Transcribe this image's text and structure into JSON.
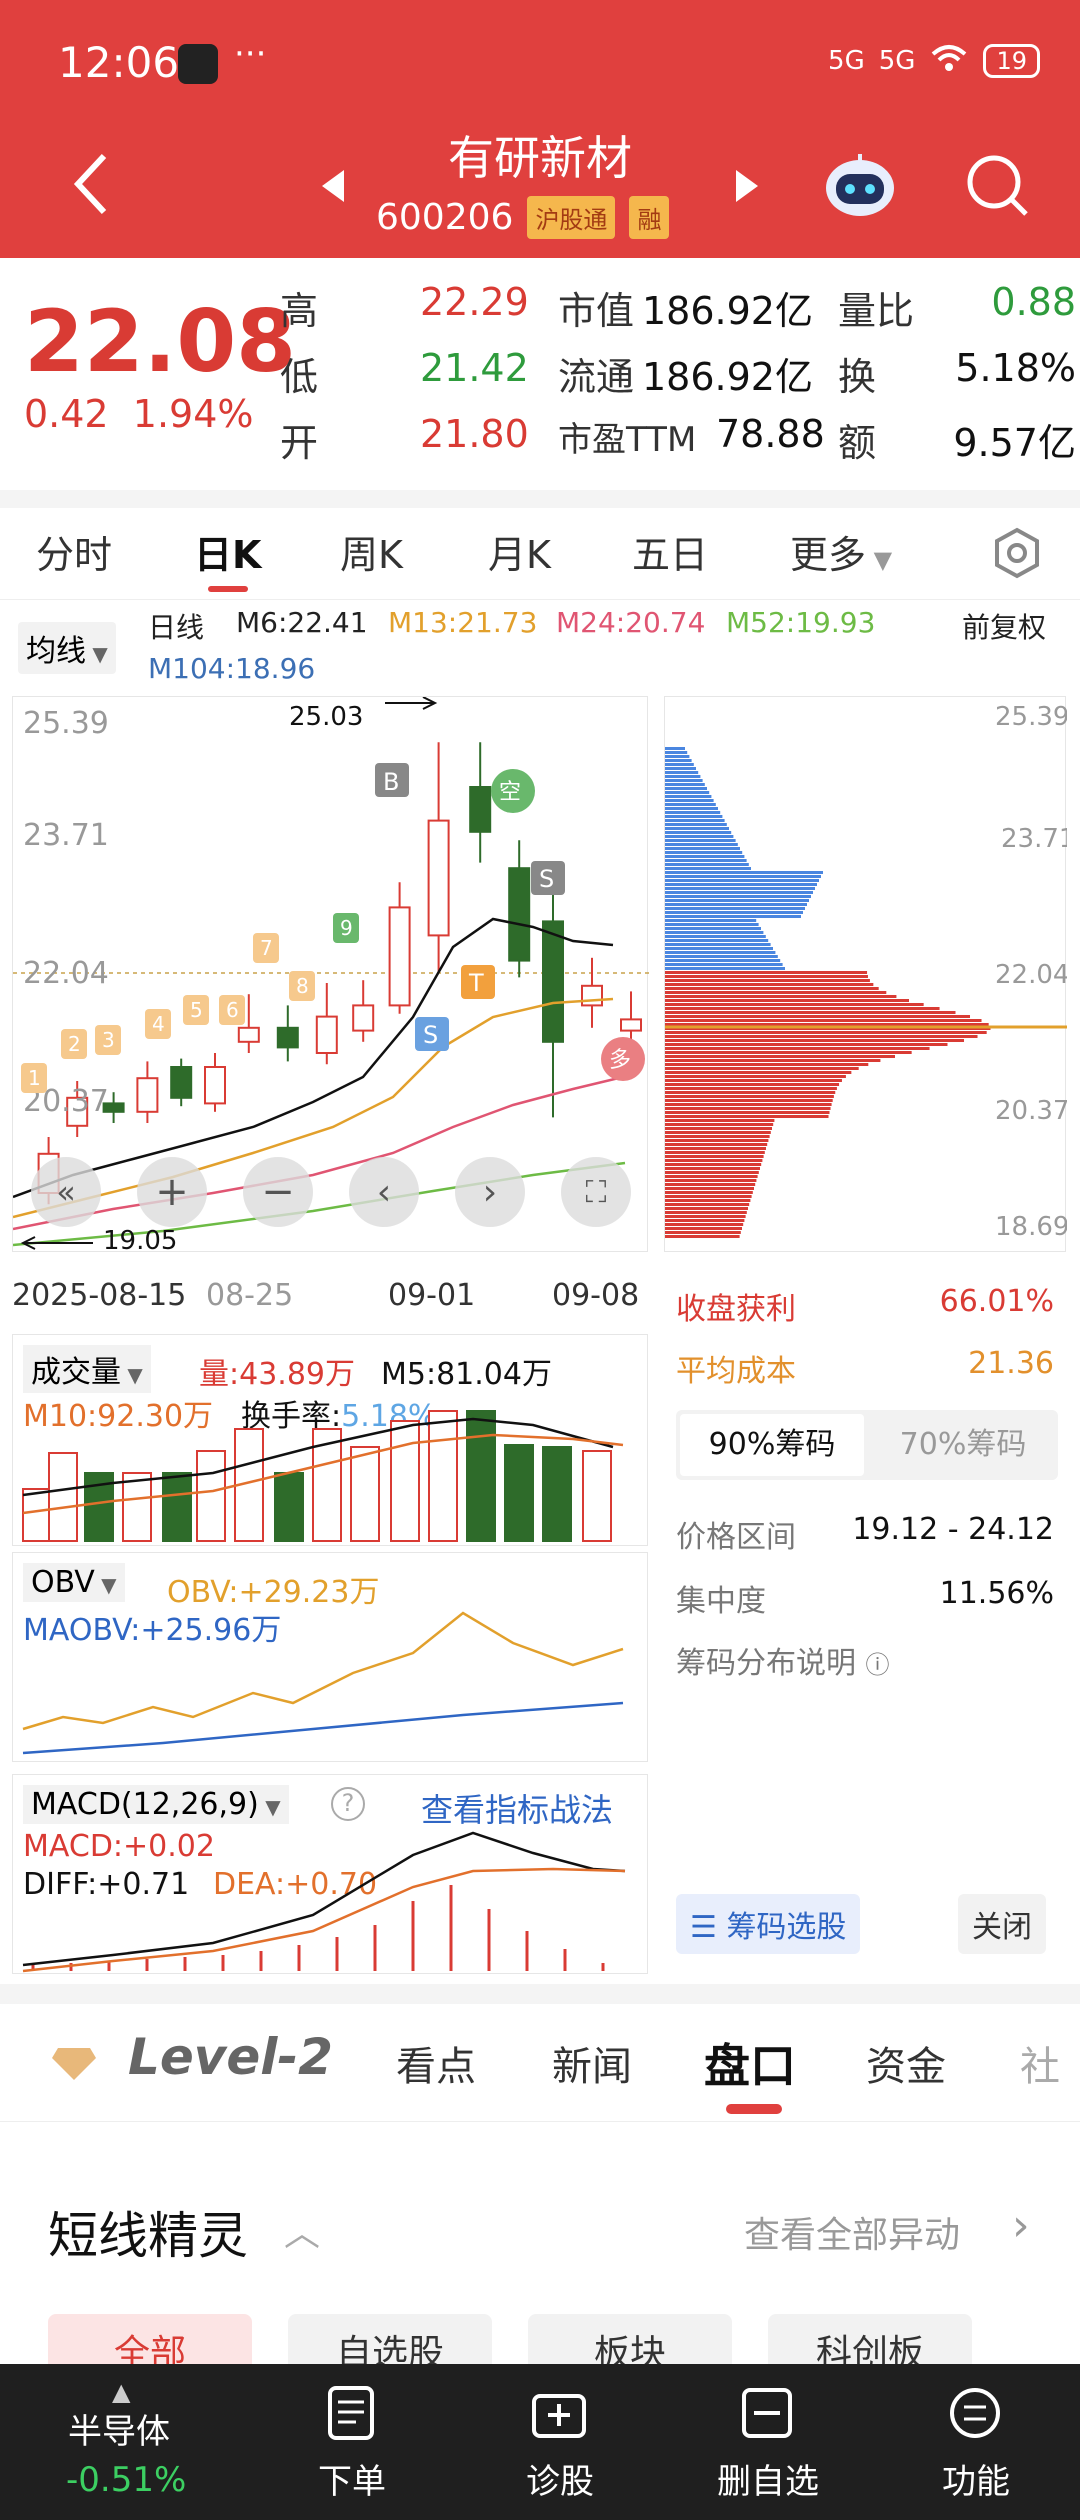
{
  "status_bar": {
    "time": "12:06",
    "dots": "···",
    "signal1": "5G",
    "signal2": "5G",
    "battery": "19"
  },
  "header": {
    "stock_name": "有研新材",
    "stock_code": "600206",
    "tag1": "沪股通",
    "tag2": "融"
  },
  "quote": {
    "price": "22.08",
    "change": "0.42",
    "change_pct": "1.94%",
    "high_label": "高",
    "high": "22.29",
    "low_label": "低",
    "low": "21.42",
    "open_label": "开",
    "open": "21.80",
    "mcap_label": "市值",
    "mcap": "186.92亿",
    "float_label": "流通",
    "float": "186.92亿",
    "pe_label": "市盈TTM",
    "pe": "78.88",
    "vr_label": "量比",
    "vr": "0.88",
    "turn_label": "换",
    "turn": "5.18%",
    "amt_label": "额",
    "amt": "9.57亿"
  },
  "tabs": [
    "分时",
    "日K",
    "周K",
    "月K",
    "五日",
    "更多"
  ],
  "ma": {
    "selector": "均线",
    "type": "日线",
    "m6": "M6:22.41",
    "m13": "M13:21.73",
    "m24": "M24:20.74",
    "m52": "M52:19.93",
    "m104": "M104:18.96",
    "adjust": "前复权"
  },
  "kline": {
    "y_labels": [
      "25.39",
      "23.71",
      "22.04",
      "20.37",
      "18.69"
    ],
    "x_labels": [
      "2025-08-15",
      "08-25",
      "09-01",
      "09-08"
    ],
    "high_mark": "25.03",
    "low_mark": "19.05"
  },
  "volume": {
    "title": "成交量",
    "vol": "量:43.89万",
    "m5": "M5:81.04万",
    "m10": "M10:92.30万",
    "turnover_label": "换手率:",
    "turnover": "5.18%"
  },
  "obv": {
    "title": "OBV",
    "obv": "OBV:+29.23万",
    "maobv": "MAOBV:+25.96万"
  },
  "macd": {
    "title": "MACD(12,26,9)",
    "link": "查看指标战法",
    "macd": "MACD:+0.02",
    "diff": "DIFF:+0.71",
    "dea": "DEA:+0.70"
  },
  "chips": {
    "profit_label": "收盘获利",
    "profit": "66.01%",
    "cost_label": "平均成本",
    "cost": "21.36",
    "tab90": "90%筹码",
    "tab70": "70%筹码",
    "range_label": "价格区间",
    "range": "19.12 - 24.12",
    "conc_label": "集中度",
    "conc": "11.56%",
    "note": "筹码分布说明",
    "select_btn": "筹码选股",
    "close_btn": "关闭"
  },
  "section_tabs": [
    "Level-2",
    "看点",
    "新闻",
    "盘口",
    "资金",
    "社"
  ],
  "spirit": {
    "title": "短线精灵",
    "view_all": "查看全部异动",
    "chips": [
      "全部",
      "自选股",
      "板块",
      "科创板"
    ]
  },
  "bottom": {
    "sector": "半导体",
    "sector_pct": "-0.51%",
    "items": [
      "下单",
      "诊股",
      "删自选",
      "功能"
    ]
  },
  "colors": {
    "brand_red": "#e0403e",
    "up": "#d93b34",
    "down": "#2e6b2a"
  }
}
